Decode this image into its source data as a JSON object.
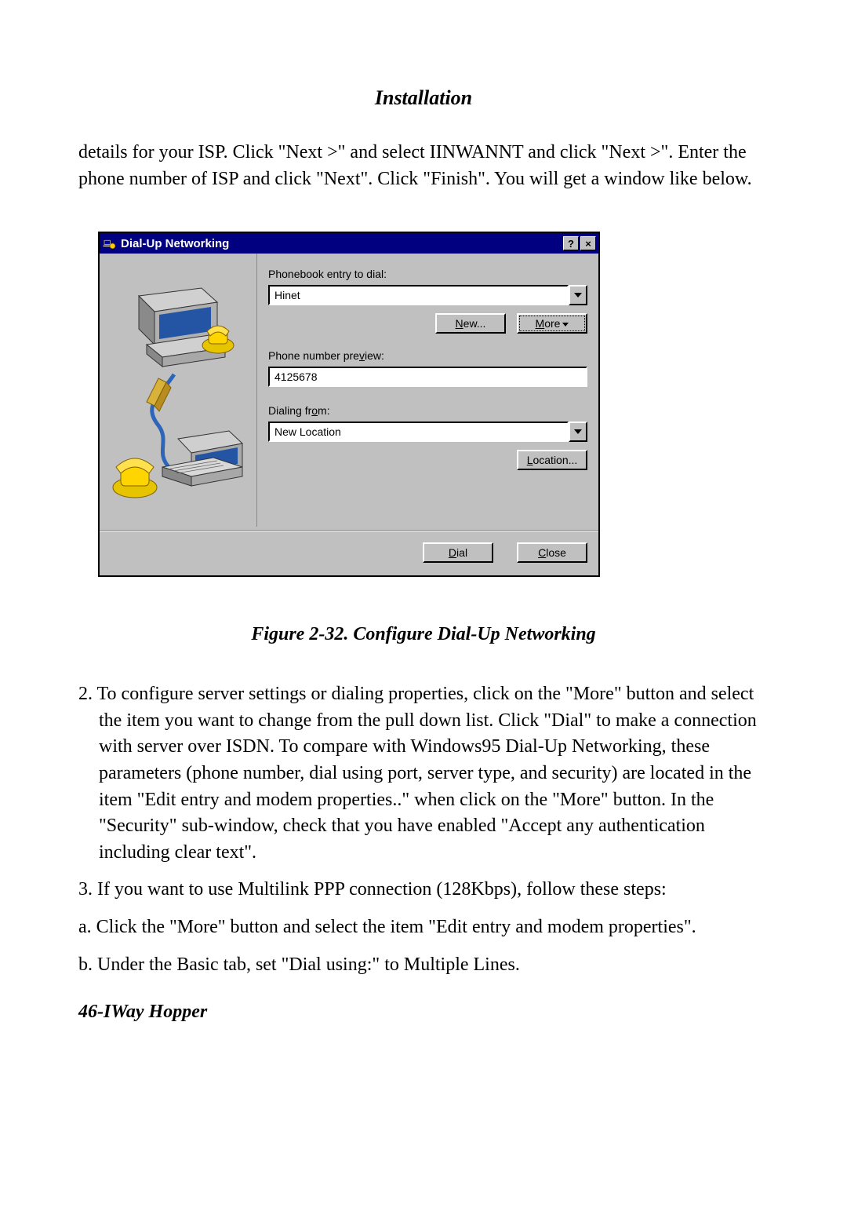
{
  "page": {
    "heading": "Installation",
    "intro_paragraph": "details for your ISP.  Click \"Next >\" and select IINWANNT and click \"Next >\".  Enter the phone number of ISP and click \"Next\". Click \"Finish\".  You will get a window like below.",
    "figure_caption": "Figure 2-32. Configure Dial-Up Networking",
    "item2": "2. To configure server settings or dialing properties, click on the \"More\" button and select the item you want to change from the pull down list.  Click \"Dial\" to make a connection with server over ISDN.  To compare with Windows95 Dial-Up Networking, these parameters (phone number, dial using port, server type, and security) are located in the item \"Edit entry and modem properties..\" when click on the \"More\" button.  In the \"Security\" sub-window, check that you have enabled \"Accept any authentication including clear text\".",
    "item3": "3. If you want to use Multilink PPP connection (128Kbps), follow these steps:",
    "item_a": "a. Click the \"More\" button and select the item \"Edit entry and modem properties\".",
    "item_b": "b. Under the Basic tab, set \"Dial using:\" to Multiple Lines.",
    "footer": "46-IWay Hopper"
  },
  "dialog": {
    "title": "Dial-Up Networking",
    "help_btn": "?",
    "close_btn": "×",
    "label_phonebook": "Phonebook entry to dial:",
    "phonebook_value": "Hinet",
    "btn_new": "New...",
    "btn_more": "More",
    "label_preview": "Phone number preview:",
    "preview_value": "4125678",
    "label_dialfrom": "Dialing from:",
    "dialfrom_value": "New Location",
    "btn_location": "Location...",
    "btn_dial": "Dial",
    "btn_close": "Close"
  }
}
